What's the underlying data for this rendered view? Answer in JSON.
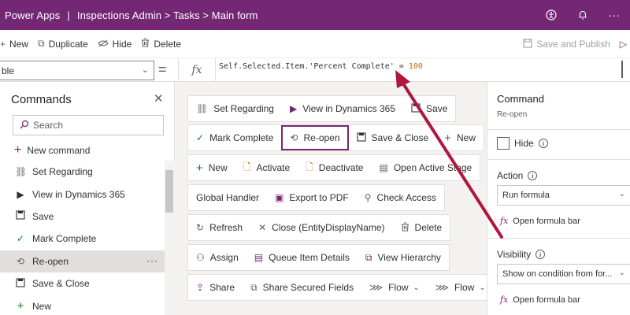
{
  "header": {
    "app": "Power Apps",
    "context": "Inspections Admin > Tasks > Main form",
    "icons": [
      "accessibility-icon",
      "bell-icon",
      "more-icon"
    ]
  },
  "commandbar": {
    "new": "New",
    "duplicate": "Duplicate",
    "hide": "Hide",
    "delete": "Delete",
    "save_publish": "Save and Publish"
  },
  "formulabar": {
    "property": "ble",
    "equals": "=",
    "fx": "fx",
    "formula_text": "Self.Selected.Item.'Percent Complete' = ",
    "formula_value": "100"
  },
  "commands_panel": {
    "title": "Commands",
    "search_placeholder": "Search",
    "new_command": "New command",
    "items": [
      {
        "label": "Set Regarding",
        "icon": "link-icon"
      },
      {
        "label": "View in Dynamics 365",
        "icon": "dynamics-icon"
      },
      {
        "label": "Save",
        "icon": "save-icon"
      },
      {
        "label": "Mark Complete",
        "icon": "check-icon"
      },
      {
        "label": "Re-open",
        "icon": "history-icon",
        "selected": true
      },
      {
        "label": "Save & Close",
        "icon": "save-close-icon"
      },
      {
        "label": "New",
        "icon": "plus-icon"
      }
    ]
  },
  "canvas": {
    "rows": [
      [
        "Set Regarding",
        "View in Dynamics 365",
        "Save"
      ],
      [
        "Mark Complete",
        "Re-open",
        "Save & Close",
        "New"
      ],
      [
        "New",
        "Activate",
        "Deactivate",
        "Open Active Stage"
      ],
      [
        "Global Handler",
        "Export to PDF",
        "Check Access"
      ],
      [
        "Refresh",
        "Close (EntityDisplayName)",
        "Delete"
      ],
      [
        "Assign",
        "Queue Item Details",
        "View Hierarchy"
      ],
      [
        "Share",
        "Share Secured Fields",
        "Flow",
        "Flow"
      ]
    ]
  },
  "properties": {
    "title": "Command",
    "subtitle": "Re-open",
    "hide_label": "Hide",
    "action_label": "Action",
    "action_value": "Run formula",
    "open_formula_bar": "Open formula bar",
    "visibility_label": "Visibility",
    "visibility_value": "Show on condition from for...",
    "open_formula_bar_2": "Open formula bar"
  },
  "colors": {
    "brand": "#742774",
    "annotation_arrow": "#b0173c"
  }
}
